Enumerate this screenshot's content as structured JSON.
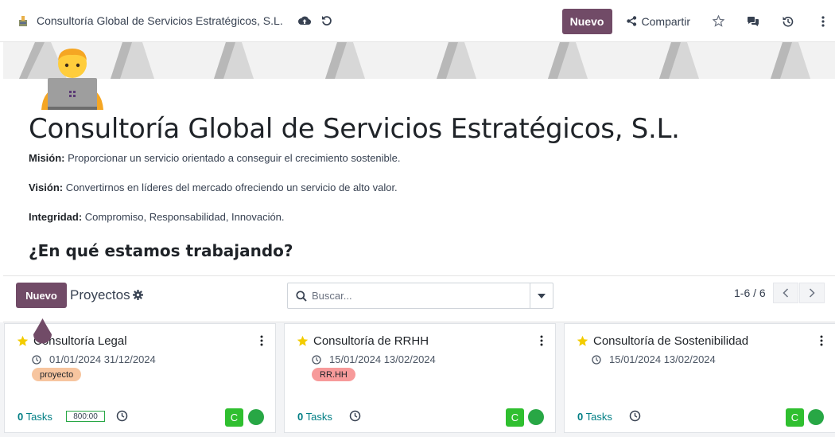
{
  "topbar": {
    "breadcrumb": "Consultoría Global de Servicios Estratégicos, S.L.",
    "new_label": "Nuevo",
    "share_label": "Compartir"
  },
  "hero": {
    "title": "Consultoría Global de Servicios Estratégicos, S.L.",
    "lines": [
      {
        "label": "Misión:",
        "text": " Proporcionar un servicio orientado a conseguir el crecimiento sostenible."
      },
      {
        "label": "Visión:",
        "text": " Convertirnos en líderes del mercado ofreciendo un servicio de alto valor."
      },
      {
        "label": "Integridad:",
        "text": " Compromiso, Responsabilidad, Innovación."
      }
    ],
    "subheading": "¿En qué estamos trabajando?"
  },
  "control_panel": {
    "new_label": "Nuevo",
    "title": "Proyectos",
    "search_placeholder": "Buscar...",
    "pager": "1-6 / 6"
  },
  "cards": [
    {
      "title": "Consultoría Legal",
      "start": "01/01/2024",
      "end": "31/12/2024",
      "tag": "proyecto",
      "tag_color": "#f7c59f",
      "tasks_count": "0",
      "tasks_label": "Tasks",
      "hours": "800:00",
      "avatar": "C",
      "starred": true
    },
    {
      "title": "Consultoría de RRHH",
      "start": "15/01/2024",
      "end": "13/02/2024",
      "tag": "RR.HH",
      "tag_color": "#f79a9a",
      "tasks_count": "0",
      "tasks_label": "Tasks",
      "hours": "",
      "avatar": "C",
      "starred": true
    },
    {
      "title": "Consultoría de Sostenibilidad",
      "start": "15/01/2024",
      "end": "13/02/2024",
      "tag": "",
      "tag_color": "",
      "tasks_count": "0",
      "tasks_label": "Tasks",
      "hours": "",
      "avatar": "C",
      "starred": true
    }
  ],
  "colors": {
    "brand": "#714B67",
    "star": "#f3cc00",
    "success": "#28a745"
  }
}
